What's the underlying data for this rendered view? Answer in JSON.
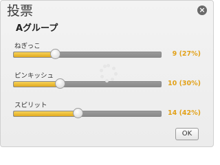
{
  "dialog": {
    "title": "投票",
    "close_symbol": "×",
    "group_title": "Aグループ"
  },
  "options": [
    {
      "label": "ねぎっこ",
      "count_text": "9 (27%)",
      "percent": 27
    },
    {
      "label": "ピンキッシュ",
      "count_text": "10 (30%)",
      "percent": 30
    },
    {
      "label": "スピリット",
      "count_text": "14 (42%)",
      "percent": 42
    }
  ],
  "buttons": {
    "ok_label": "OK"
  },
  "colors": {
    "accent": "#e2a118",
    "fill": "#f0c13a",
    "track": "#8f8f8f"
  },
  "icons": {
    "close": "close-icon",
    "loading": "spinner-icon"
  }
}
